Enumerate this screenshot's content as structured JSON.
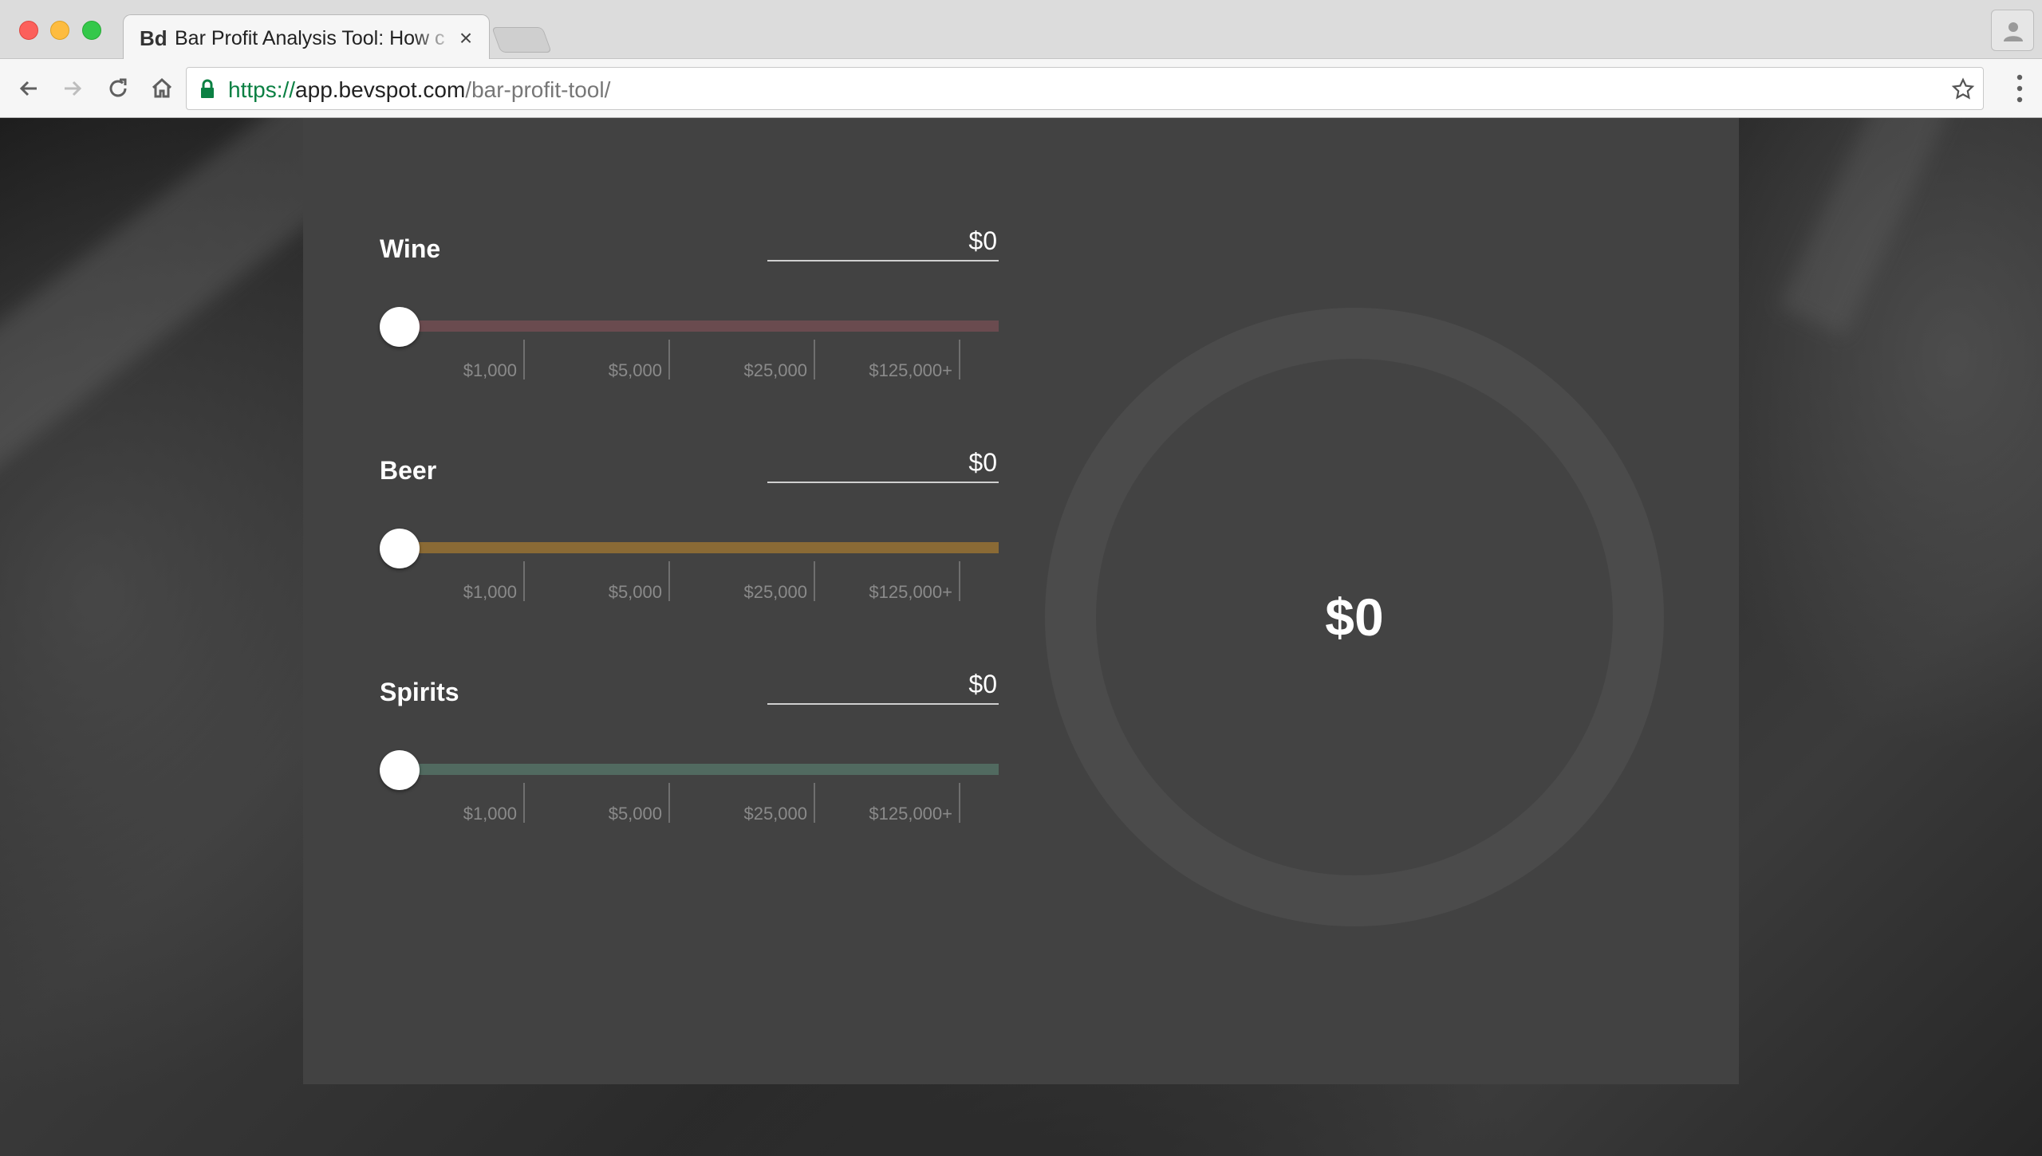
{
  "browser": {
    "tab_title": "Bar Profit Analysis Tool: How c",
    "favicon_text": "Bd",
    "url_scheme": "https://",
    "url_host": "app.bevspot.com",
    "url_path": "/bar-profit-tool/"
  },
  "calculator": {
    "categories": [
      {
        "label": "Wine",
        "value": "$0",
        "track_color": "#6a4b4f",
        "slider_level": 0
      },
      {
        "label": "Beer",
        "value": "$0",
        "track_color": "#8a6a35",
        "slider_level": 0
      },
      {
        "label": "Spirits",
        "value": "$0",
        "track_color": "#516a60",
        "slider_level": 0
      }
    ],
    "tick_labels": [
      "$1,000",
      "$5,000",
      "$25,000",
      "$125,000+"
    ],
    "total": "$0"
  }
}
